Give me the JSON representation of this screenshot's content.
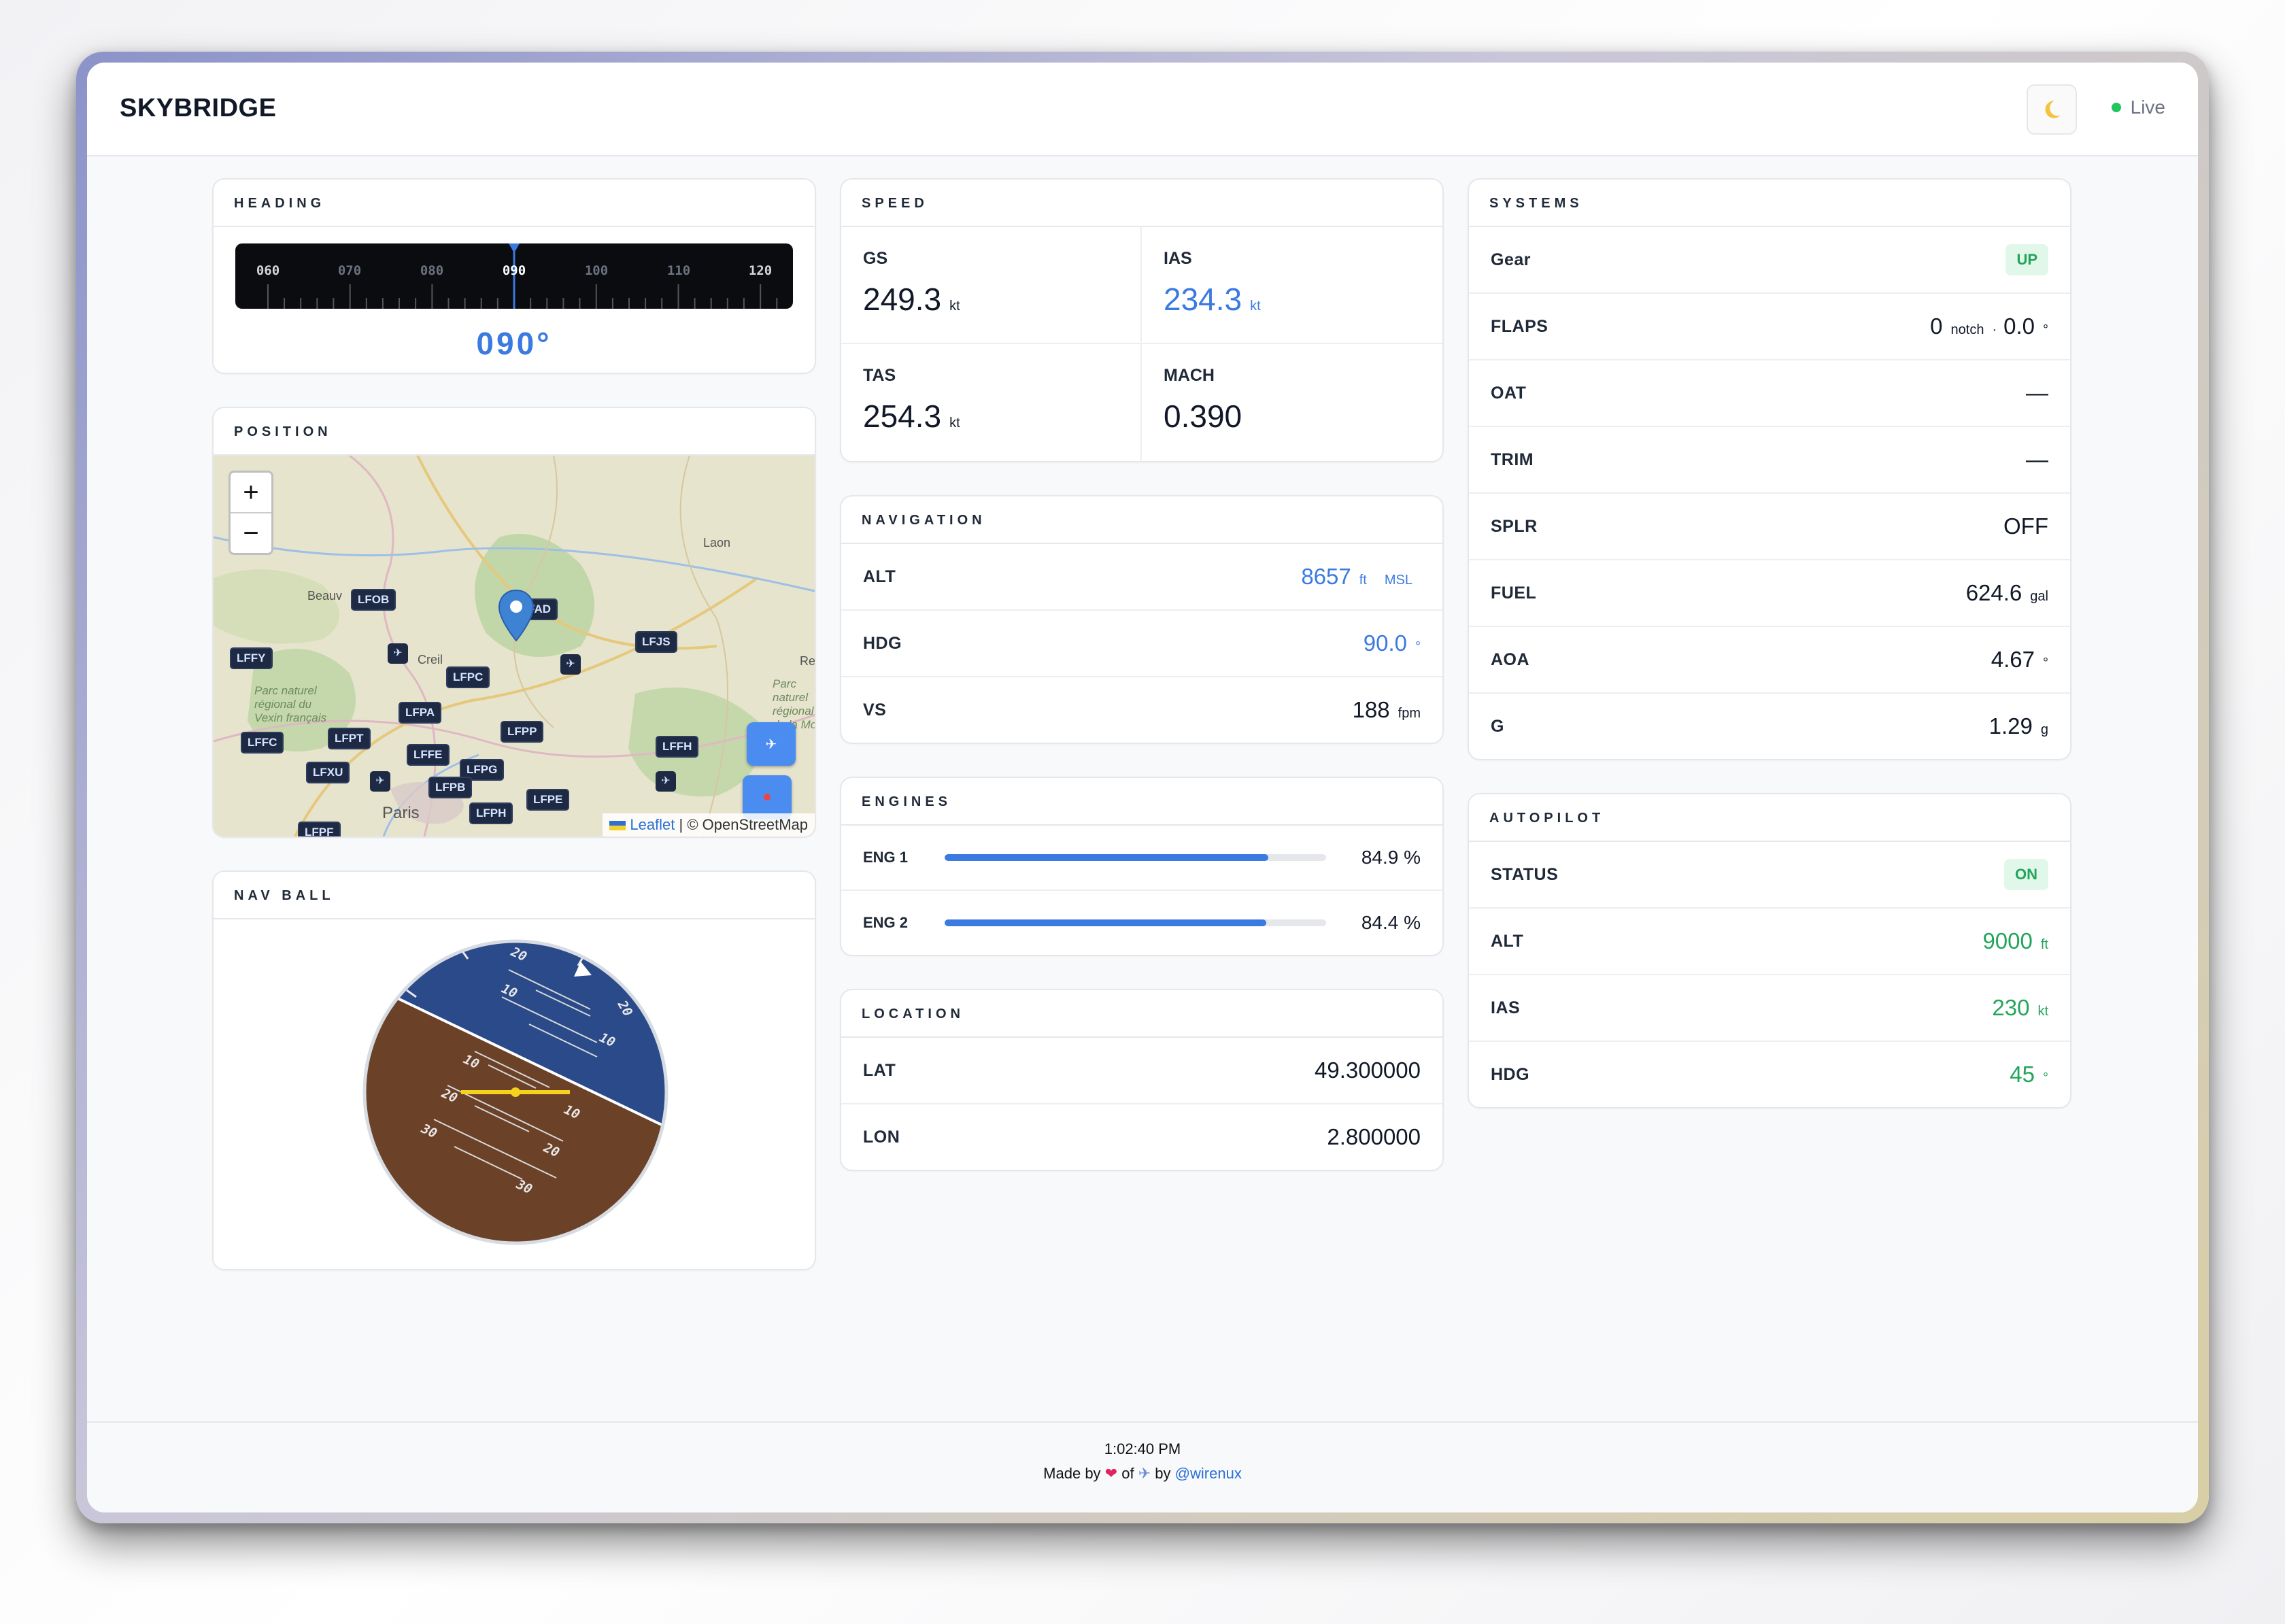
{
  "app": {
    "title": "SKYBRIDGE",
    "status_label": "Live",
    "theme_icon": "moon-icon"
  },
  "heading": {
    "title": "HEADING",
    "scale_labels": [
      "060",
      "070",
      "080",
      "090",
      "100",
      "110",
      "120"
    ],
    "value": "090°"
  },
  "position": {
    "title": "POSITION",
    "zoom_in": "+",
    "zoom_out": "−",
    "places": [
      "Beauv",
      "Creil",
      "Laon",
      "Paris",
      "Parc naturel régional du Vexin français",
      "Parc naturel régional de la Mo",
      "Re"
    ],
    "airports": [
      "LFOB",
      "LFFY",
      "LFPC",
      "LFJS",
      "LFPA",
      "LFPP",
      "LFFC",
      "LFPT",
      "LFFE",
      "LFFH",
      "LFXU",
      "LFPG",
      "LFPB",
      "LFPE",
      "LFPH",
      "LFPF",
      "FAD"
    ],
    "attribution_link": "Leaflet",
    "attribution_text": "| © OpenStreetMap"
  },
  "navball": {
    "title": "NAV BALL",
    "pitch_labels": [
      "10",
      "20",
      "30",
      "10",
      "20",
      "30"
    ],
    "roll_labels": [
      "10",
      "20"
    ],
    "sky_color": "#2a4a8a",
    "ground_color": "#6b4128"
  },
  "speed": {
    "title": "SPEED",
    "items": [
      {
        "label": "GS",
        "value": "249.3",
        "unit": "kt"
      },
      {
        "label": "IAS",
        "value": "234.3",
        "unit": "kt"
      },
      {
        "label": "TAS",
        "value": "254.3",
        "unit": "kt"
      },
      {
        "label": "MACH",
        "value": "0.390",
        "unit": ""
      }
    ]
  },
  "navigation": {
    "title": "NAVIGATION",
    "alt": {
      "label": "ALT",
      "value": "8657",
      "unit": "ft",
      "ref": "MSL"
    },
    "hdg": {
      "label": "HDG",
      "value": "90.0",
      "unit": "°"
    },
    "vs": {
      "label": "VS",
      "value": "188",
      "unit": "fpm"
    }
  },
  "engines": {
    "title": "ENGINES",
    "items": [
      {
        "label": "ENG 1",
        "value": "84.9 %",
        "fraction": 0.849
      },
      {
        "label": "ENG 2",
        "value": "84.4 %",
        "fraction": 0.844
      }
    ]
  },
  "location": {
    "title": "LOCATION",
    "lat": {
      "label": "LAT",
      "value": "49.300000"
    },
    "lon": {
      "label": "LON",
      "value": "2.800000"
    }
  },
  "systems": {
    "title": "SYSTEMS",
    "gear": {
      "label": "Gear",
      "value": "UP"
    },
    "flaps": {
      "label": "FLAPS",
      "notch_value": "0",
      "notch_unit": "notch",
      "sep": "·",
      "deg_value": "0.0",
      "deg_unit": "°"
    },
    "oat": {
      "label": "OAT",
      "value": "—"
    },
    "trim": {
      "label": "TRIM",
      "value": "—"
    },
    "splr": {
      "label": "SPLR",
      "value": "OFF"
    },
    "fuel": {
      "label": "FUEL",
      "value": "624.6",
      "unit": "gal"
    },
    "aoa": {
      "label": "AOA",
      "value": "4.67",
      "unit": "°"
    },
    "g": {
      "label": "G",
      "value": "1.29",
      "unit": "g"
    }
  },
  "autopilot": {
    "title": "AUTOPILOT",
    "status": {
      "label": "STATUS",
      "value": "ON"
    },
    "alt": {
      "label": "ALT",
      "value": "9000",
      "unit": "ft"
    },
    "ias": {
      "label": "IAS",
      "value": "230",
      "unit": "kt"
    },
    "hdg": {
      "label": "HDG",
      "value": "45",
      "unit": "°"
    }
  },
  "footer": {
    "time": "1:02:40 PM",
    "made_by": "Made by",
    "of": "of",
    "by": "by",
    "handle": "@wirenux"
  },
  "colors": {
    "accent": "#3b7ae0",
    "ok": "#22a55a",
    "live": "#22c55e"
  }
}
